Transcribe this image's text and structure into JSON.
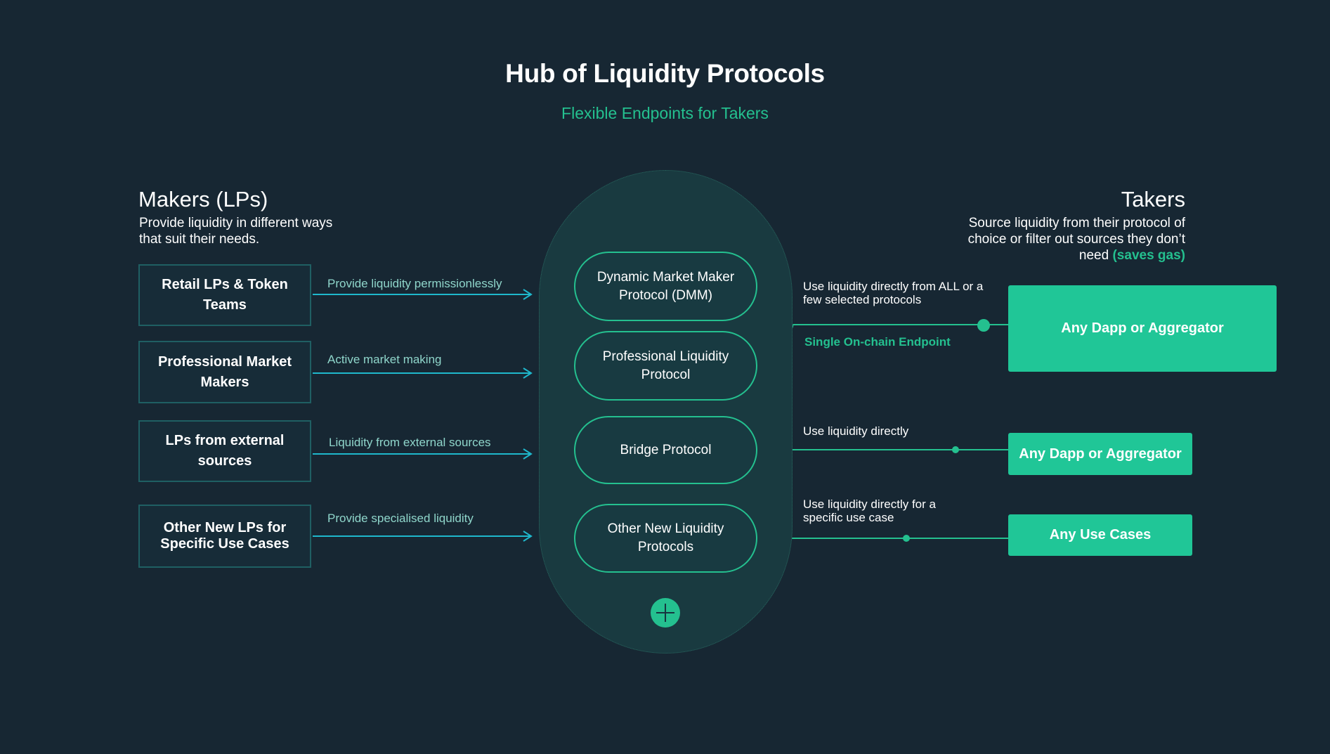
{
  "header": {
    "title": "Hub of Liquidity Protocols",
    "subtitle": "Flexible Endpoints for Takers"
  },
  "makers": {
    "title": "Makers (LPs)",
    "description": "Provide liquidity in different ways that suit their needs.",
    "items": [
      {
        "label": "Retail LPs & Token Teams",
        "arrow_label": "Provide liquidity permissionlessly"
      },
      {
        "label": "Professional Market Makers",
        "arrow_label": "Active market making"
      },
      {
        "label": "LPs from external sources",
        "arrow_label": "Liquidity from external sources"
      },
      {
        "label": "Other New LPs for Specific Use Cases",
        "arrow_label": "Provide specialised liquidity"
      }
    ]
  },
  "hub": {
    "protocols": [
      {
        "label": "Dynamic Market Maker Protocol (DMM)"
      },
      {
        "label": "Professional Liquidity Protocol"
      },
      {
        "label": "Bridge Protocol"
      },
      {
        "label": "Other New Liquidity Protocols"
      }
    ],
    "add_icon": "plus-icon"
  },
  "takers": {
    "title": "Takers",
    "description": "Source liquidity from their protocol of choice or filter out sources they don’t need",
    "description_highlight": "(saves gas)",
    "routes": [
      {
        "label": "Use liquidity directly from ALL or a few selected protocols",
        "sublabel": "Single On-chain Endpoint",
        "target": "Any Dapp or Aggregator"
      },
      {
        "label": "Use liquidity directly",
        "target": "Any Dapp or Aggregator"
      },
      {
        "label": "Use liquidity directly for a specific use case",
        "target": "Any Use Cases"
      }
    ]
  },
  "colors": {
    "background": "#172733",
    "accent_green": "#24c08f",
    "arrow_cyan": "#1fb8cc",
    "hub_fill": "#193a40"
  }
}
